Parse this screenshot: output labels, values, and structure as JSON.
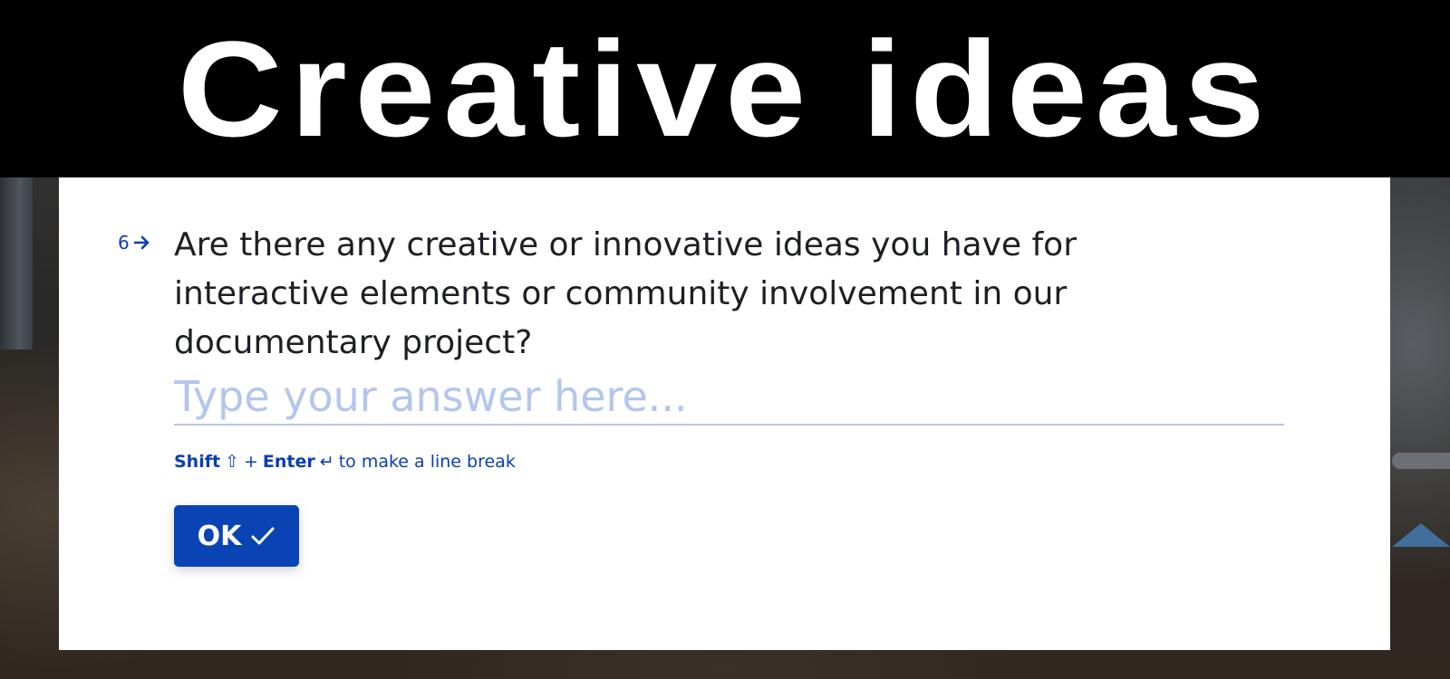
{
  "banner": {
    "title": "Creative ideas"
  },
  "question": {
    "number": "6",
    "text": "Are there any creative or innovative ideas you have for interactive elements or community involvement in our documentary project?"
  },
  "answer": {
    "placeholder": "Type your answer here...",
    "value": ""
  },
  "hint": {
    "shift": "Shift",
    "shift_symbol": "⇧",
    "plus": "+",
    "enter": "Enter",
    "enter_symbol": "↵",
    "suffix": "to make a line break"
  },
  "ok_button": {
    "label": "OK"
  },
  "colors": {
    "accent": "#0a44b4",
    "question_text": "#1d1f24",
    "placeholder": "#b3c6ec",
    "banner_bg": "#000000",
    "banner_text": "#ffffff"
  },
  "icons": {
    "question_arrow": "arrow-right-icon",
    "ok": "check-icon",
    "shift": "shift-icon",
    "enter": "enter-icon"
  }
}
